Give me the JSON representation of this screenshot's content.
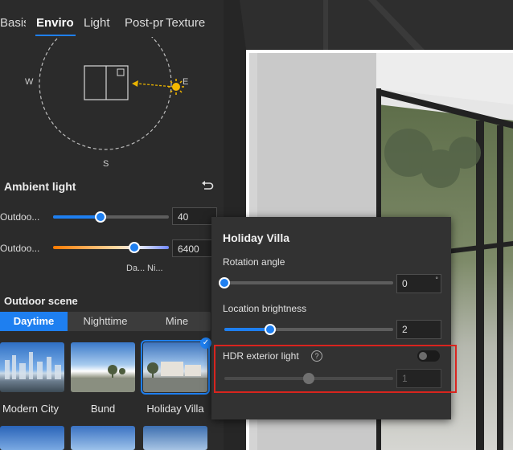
{
  "tabs": [
    "Basis",
    "Enviro",
    "Light",
    "Post-pr",
    "Texture"
  ],
  "active_tab": "Enviro",
  "compass": {
    "west": "W",
    "east": "E",
    "south": "S"
  },
  "ambient": {
    "title": "Ambient light",
    "rows": [
      {
        "label": "Outdoo...",
        "value": "40",
        "slider_fraction": 0.41
      },
      {
        "label": "Outdoo...",
        "value": "6400",
        "slider_fraction": 0.7
      }
    ],
    "gradient_labels": [
      "Da...",
      "Ni..."
    ]
  },
  "scene": {
    "title": "Outdoor scene",
    "tabs": [
      "Daytime",
      "Nighttime",
      "Mine"
    ],
    "active_tab": "Daytime",
    "items": [
      {
        "name": "Modern City",
        "selected": false
      },
      {
        "name": "Bund",
        "selected": false
      },
      {
        "name": "Holiday Villa",
        "selected": true
      }
    ]
  },
  "popup": {
    "title": "Holiday Villa",
    "rotation_label": "Rotation angle",
    "rotation_value": "0",
    "rotation_unit": "°",
    "rotation_fraction": 0.0,
    "brightness_label": "Location brightness",
    "brightness_value": "2",
    "brightness_fraction": 0.27,
    "hdr_label": "HDR exterior light",
    "hdr_help": "?",
    "hdr_enabled": false,
    "hdr_value": "1",
    "hdr_fraction": 0.5
  },
  "icons": {
    "reset": "reset-icon",
    "check": "✓",
    "sun": "sun-icon"
  },
  "colors": {
    "accent": "#1e7ff0",
    "highlight": "#d9241e",
    "panel": "#2b2b2b",
    "popup": "#323232"
  }
}
